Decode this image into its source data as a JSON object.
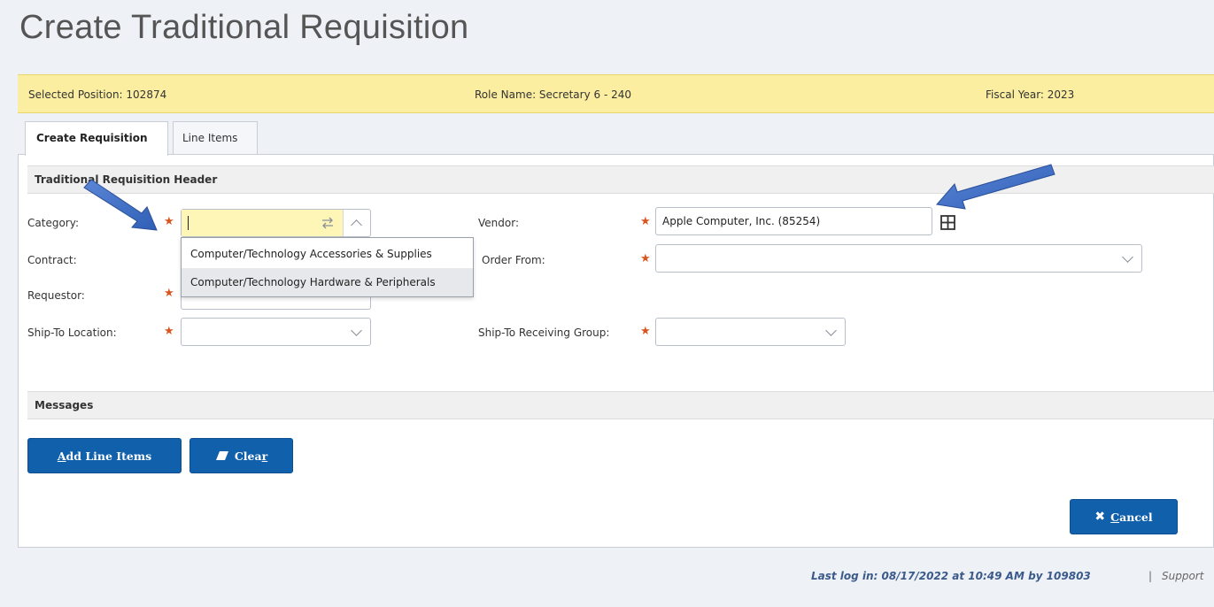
{
  "page": {
    "title": "Create Traditional Requisition"
  },
  "info_bar": {
    "selected_position": "Selected Position: 102874",
    "role_name": "Role Name: Secretary 6 - 240",
    "fiscal_year": "Fiscal Year: 2023"
  },
  "tabs": [
    {
      "label": "Create Requisition",
      "active": true
    },
    {
      "label": "Line Items",
      "active": false
    }
  ],
  "header_section": {
    "title": "Traditional Requisition Header"
  },
  "form": {
    "category": {
      "label": "Category:",
      "value": ""
    },
    "contract": {
      "label": "Contract:"
    },
    "requestor": {
      "label": "Requestor:"
    },
    "ship_to_location": {
      "label": "Ship-To Location:",
      "value": ""
    },
    "vendor": {
      "label": "Vendor:",
      "value": "Apple Computer, Inc. (85254)"
    },
    "order_from": {
      "label": "Order From:",
      "value": ""
    },
    "ship_to_receiving_group": {
      "label": "Ship-To Receiving Group:",
      "value": ""
    }
  },
  "category_dropdown": {
    "options": [
      "Computer/Technology Accessories & Supplies",
      "Computer/Technology Hardware & Peripherals"
    ],
    "highlighted_index": 1
  },
  "messages_section": {
    "title": "Messages"
  },
  "buttons": {
    "add_line_items": {
      "prefix": "",
      "underlined": "A",
      "rest": "dd Line Items"
    },
    "clear": {
      "prefix": "Clea",
      "underlined": "r",
      "rest": ""
    },
    "cancel": {
      "prefix": "",
      "underlined": "C",
      "rest": "ancel"
    }
  },
  "footer": {
    "last_login": "Last log in: 08/17/2022 at 10:49 AM by 109803",
    "separator": "|",
    "support": "Support"
  },
  "colors": {
    "primary_button": "#1160ac",
    "info_bar": "#fbeea0",
    "required_star": "#d9541e",
    "annotation_arrow": "#3f6fc6"
  }
}
